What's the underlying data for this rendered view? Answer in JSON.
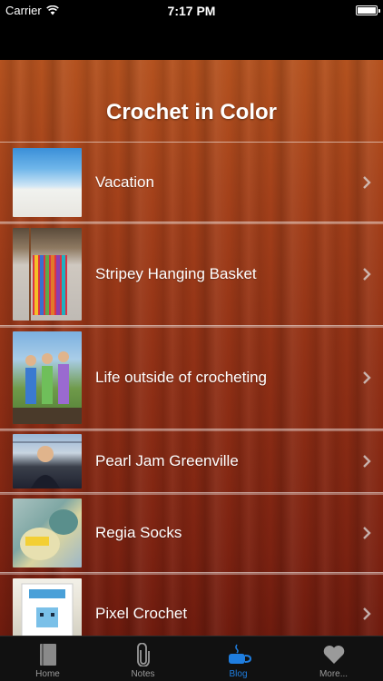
{
  "status_bar": {
    "carrier": "Carrier",
    "time": "7:17 PM"
  },
  "header": {
    "title": "Crochet in Color"
  },
  "posts": [
    {
      "title": "Vacation"
    },
    {
      "title": "Stripey Hanging Basket"
    },
    {
      "title": "Life outside of crocheting"
    },
    {
      "title": "Pearl Jam Greenville"
    },
    {
      "title": "Regia Socks"
    },
    {
      "title": "Pixel Crochet"
    }
  ],
  "tabs": [
    {
      "label": "Home",
      "icon": "book-icon"
    },
    {
      "label": "Notes",
      "icon": "paperclip-icon"
    },
    {
      "label": "Blog",
      "icon": "coffee-cup-icon",
      "active": true
    },
    {
      "label": "More...",
      "icon": "heart-icon"
    }
  ],
  "colors": {
    "active_tab": "#1f7ee0",
    "inactive_tab": "#9a9a9a"
  }
}
